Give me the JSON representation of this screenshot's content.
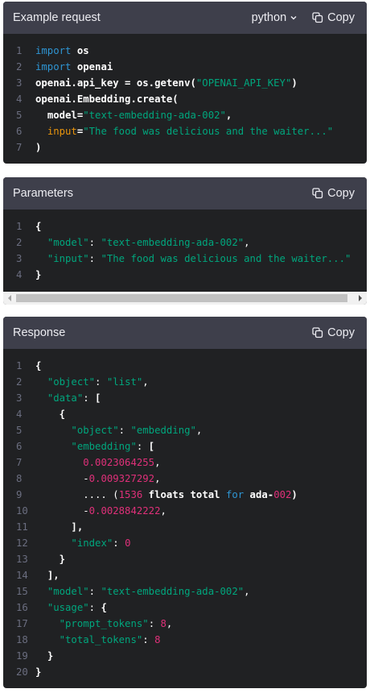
{
  "request": {
    "title": "Example request",
    "language": "python",
    "copy_label": "Copy",
    "lines": [
      {
        "n": "1",
        "parts": [
          [
            "kw",
            "import "
          ],
          [
            "bold",
            "os"
          ]
        ]
      },
      {
        "n": "2",
        "parts": [
          [
            "kw",
            "import "
          ],
          [
            "bold",
            "openai"
          ]
        ]
      },
      {
        "n": "3",
        "parts": [
          [
            "bold",
            "openai.api_key = os.getenv("
          ],
          [
            "str",
            "\"OPENAI_API_KEY\""
          ],
          [
            "bold",
            ")"
          ]
        ]
      },
      {
        "n": "4",
        "parts": [
          [
            "bold",
            "openai.Embedding.create("
          ]
        ]
      },
      {
        "n": "5",
        "parts": [
          [
            "txt",
            "  "
          ],
          [
            "bold",
            "model="
          ],
          [
            "str",
            "\"text-embedding-ada-002\""
          ],
          [
            "bold",
            ","
          ]
        ]
      },
      {
        "n": "6",
        "parts": [
          [
            "txt",
            "  "
          ],
          [
            "attr",
            "input"
          ],
          [
            "bold",
            "="
          ],
          [
            "str",
            "\"The food was delicious and the waiter...\""
          ]
        ]
      },
      {
        "n": "7",
        "parts": [
          [
            "bold",
            ")"
          ]
        ]
      }
    ]
  },
  "parameters": {
    "title": "Parameters",
    "copy_label": "Copy",
    "lines": [
      {
        "n": "1",
        "parts": [
          [
            "bold",
            "{"
          ]
        ]
      },
      {
        "n": "2",
        "parts": [
          [
            "txt",
            "  "
          ],
          [
            "str",
            "\"model\""
          ],
          [
            "txt",
            ": "
          ],
          [
            "str",
            "\"text-embedding-ada-002\""
          ],
          [
            "txt",
            ","
          ]
        ]
      },
      {
        "n": "3",
        "parts": [
          [
            "txt",
            "  "
          ],
          [
            "str",
            "\"input\""
          ],
          [
            "txt",
            ": "
          ],
          [
            "str",
            "\"The food was delicious and the waiter...\""
          ]
        ]
      },
      {
        "n": "4",
        "parts": [
          [
            "bold",
            "}"
          ]
        ]
      }
    ]
  },
  "response": {
    "title": "Response",
    "copy_label": "Copy",
    "lines": [
      {
        "n": "1",
        "parts": [
          [
            "bold",
            "{"
          ]
        ]
      },
      {
        "n": "2",
        "parts": [
          [
            "txt",
            "  "
          ],
          [
            "str",
            "\"object\""
          ],
          [
            "txt",
            ": "
          ],
          [
            "str",
            "\"list\""
          ],
          [
            "txt",
            ","
          ]
        ]
      },
      {
        "n": "3",
        "parts": [
          [
            "txt",
            "  "
          ],
          [
            "str",
            "\"data\""
          ],
          [
            "txt",
            ": "
          ],
          [
            "bold",
            "["
          ]
        ]
      },
      {
        "n": "4",
        "parts": [
          [
            "txt",
            "    "
          ],
          [
            "bold",
            "{"
          ]
        ]
      },
      {
        "n": "5",
        "parts": [
          [
            "txt",
            "      "
          ],
          [
            "str",
            "\"object\""
          ],
          [
            "txt",
            ": "
          ],
          [
            "str",
            "\"embedding\""
          ],
          [
            "txt",
            ","
          ]
        ]
      },
      {
        "n": "6",
        "parts": [
          [
            "txt",
            "      "
          ],
          [
            "str",
            "\"embedding\""
          ],
          [
            "txt",
            ": "
          ],
          [
            "bold",
            "["
          ]
        ]
      },
      {
        "n": "7",
        "parts": [
          [
            "txt",
            "        "
          ],
          [
            "num",
            "0.0023064255"
          ],
          [
            "txt",
            ","
          ]
        ]
      },
      {
        "n": "8",
        "parts": [
          [
            "txt",
            "        -"
          ],
          [
            "num",
            "0.009327292"
          ],
          [
            "txt",
            ","
          ]
        ]
      },
      {
        "n": "9",
        "parts": [
          [
            "txt",
            "        .... ("
          ],
          [
            "num",
            "1536"
          ],
          [
            "bold",
            " floats total "
          ],
          [
            "kw",
            "for"
          ],
          [
            "bold",
            " ada-"
          ],
          [
            "num",
            "002"
          ],
          [
            "bold",
            ")"
          ]
        ]
      },
      {
        "n": "10",
        "parts": [
          [
            "txt",
            "        -"
          ],
          [
            "num",
            "0.0028842222"
          ],
          [
            "txt",
            ","
          ]
        ]
      },
      {
        "n": "11",
        "parts": [
          [
            "txt",
            "      "
          ],
          [
            "bold",
            "],"
          ]
        ]
      },
      {
        "n": "12",
        "parts": [
          [
            "txt",
            "      "
          ],
          [
            "str",
            "\"index\""
          ],
          [
            "txt",
            ": "
          ],
          [
            "num",
            "0"
          ]
        ]
      },
      {
        "n": "13",
        "parts": [
          [
            "txt",
            "    "
          ],
          [
            "bold",
            "}"
          ]
        ]
      },
      {
        "n": "14",
        "parts": [
          [
            "txt",
            "  "
          ],
          [
            "bold",
            "],"
          ]
        ]
      },
      {
        "n": "15",
        "parts": [
          [
            "txt",
            "  "
          ],
          [
            "str",
            "\"model\""
          ],
          [
            "txt",
            ": "
          ],
          [
            "str",
            "\"text-embedding-ada-002\""
          ],
          [
            "txt",
            ","
          ]
        ]
      },
      {
        "n": "16",
        "parts": [
          [
            "txt",
            "  "
          ],
          [
            "str",
            "\"usage\""
          ],
          [
            "txt",
            ": "
          ],
          [
            "bold",
            "{"
          ]
        ]
      },
      {
        "n": "17",
        "parts": [
          [
            "txt",
            "    "
          ],
          [
            "str",
            "\"prompt_tokens\""
          ],
          [
            "txt",
            ": "
          ],
          [
            "num",
            "8"
          ],
          [
            "txt",
            ","
          ]
        ]
      },
      {
        "n": "18",
        "parts": [
          [
            "txt",
            "    "
          ],
          [
            "str",
            "\"total_tokens\""
          ],
          [
            "txt",
            ": "
          ],
          [
            "num",
            "8"
          ]
        ]
      },
      {
        "n": "19",
        "parts": [
          [
            "txt",
            "  "
          ],
          [
            "bold",
            "}"
          ]
        ]
      },
      {
        "n": "20",
        "parts": [
          [
            "bold",
            "}"
          ]
        ]
      }
    ]
  },
  "colors": {
    "header_bg": "#3e3f4b",
    "code_bg": "#202123",
    "keyword": "#2e95d3",
    "string": "#00a67d",
    "number": "#df3079",
    "attribute": "#e9950c",
    "line_number": "#6b6e80"
  },
  "icons": {
    "copy": "copy-icon",
    "language_dropdown": "chevron-down-icon",
    "scroll_left": "arrow-left-icon",
    "scroll_right": "arrow-right-icon"
  }
}
